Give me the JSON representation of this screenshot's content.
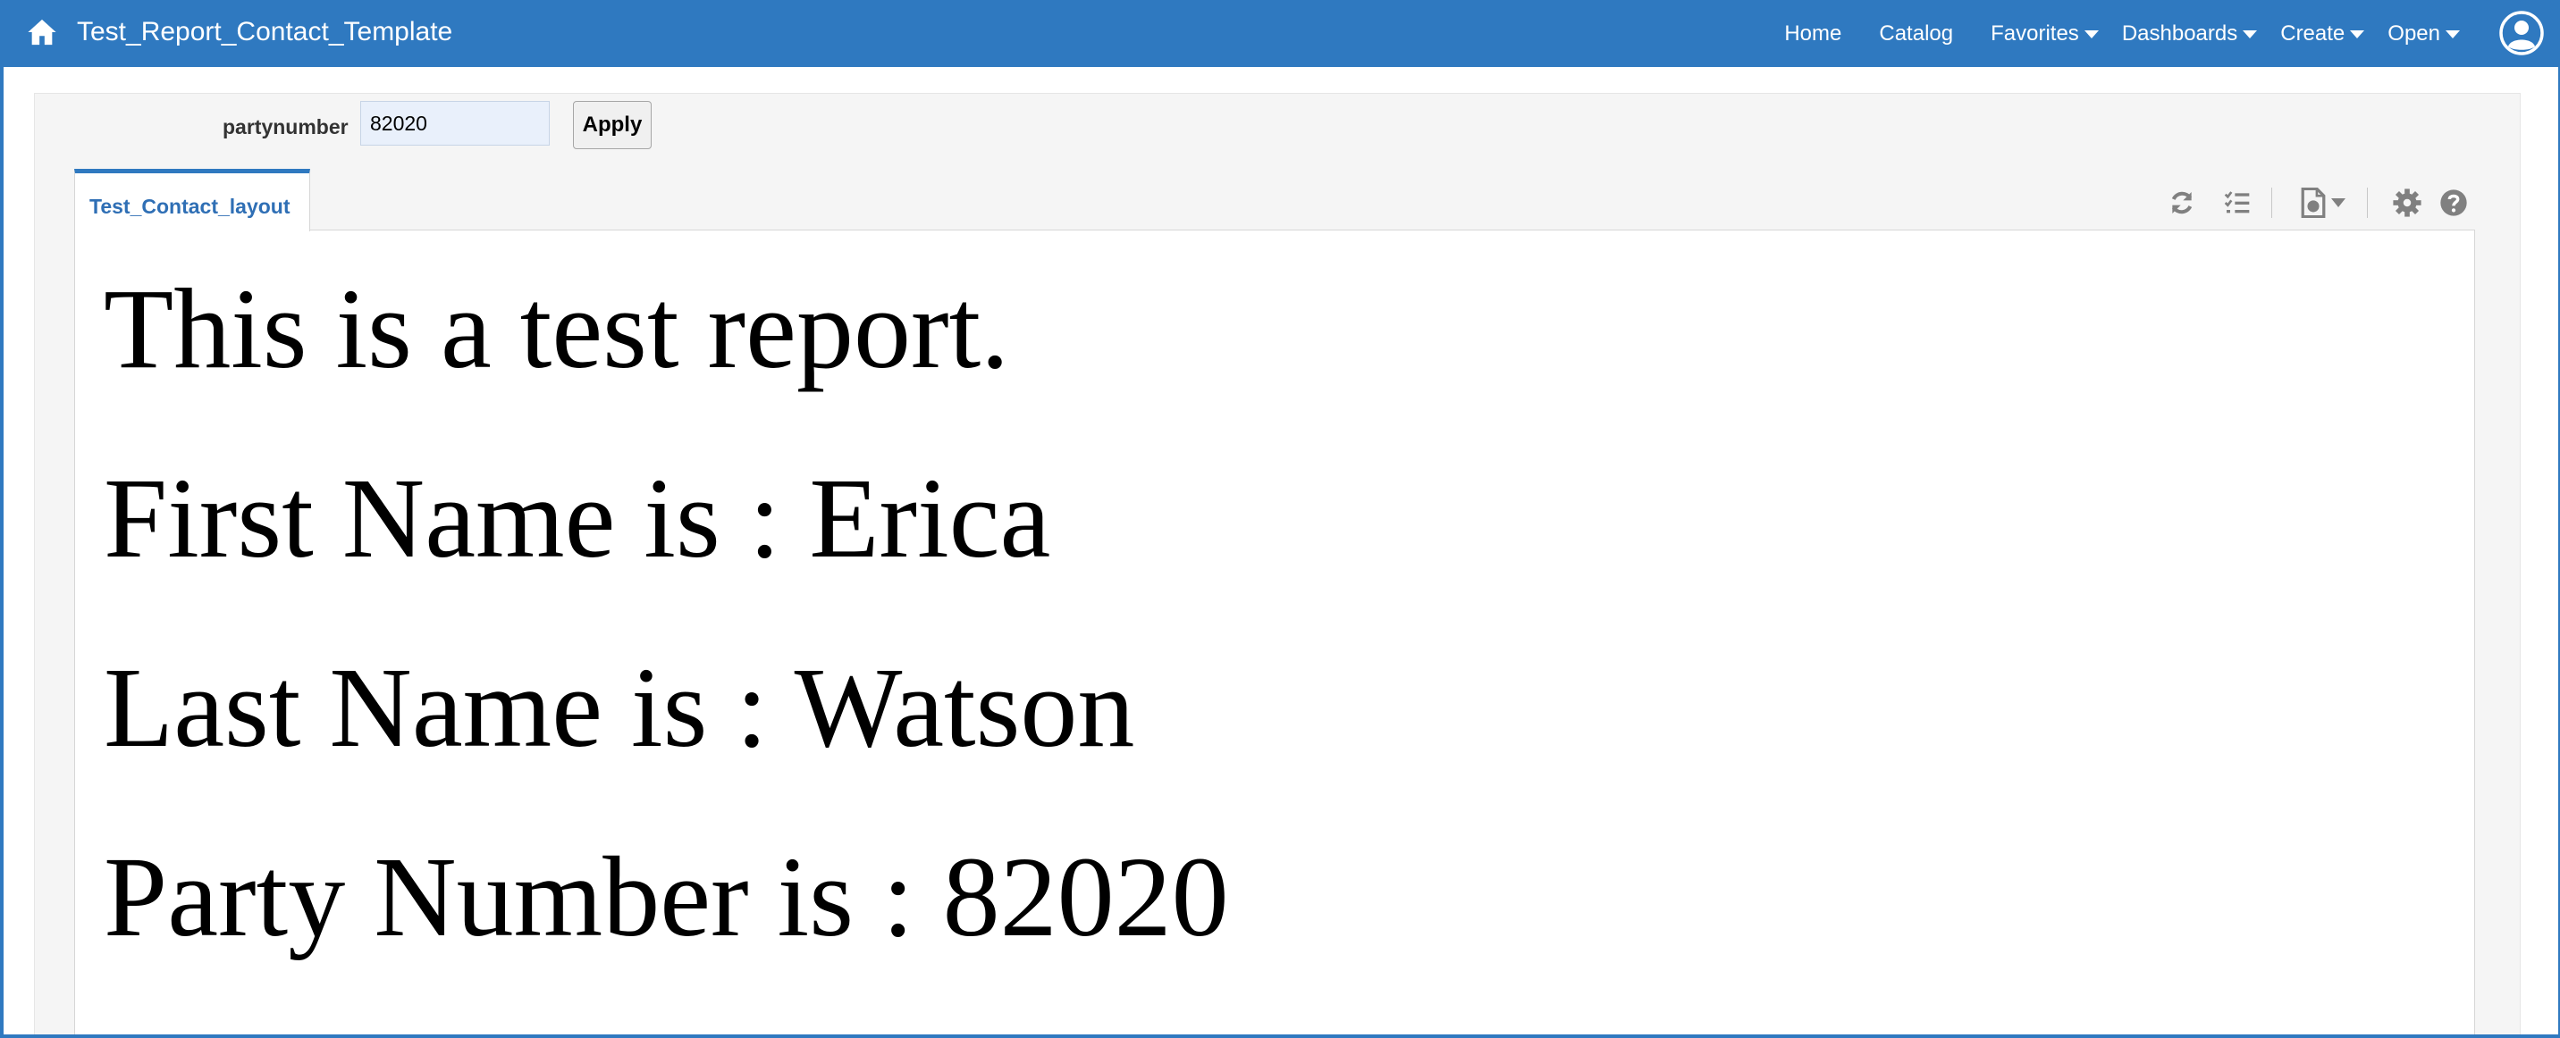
{
  "header": {
    "title": "Test_Report_Contact_Template",
    "nav": {
      "home": "Home",
      "catalog": "Catalog",
      "favorites": "Favorites",
      "dashboards": "Dashboards",
      "create": "Create",
      "open": "Open"
    }
  },
  "params": {
    "label": "partynumber",
    "value": "82020",
    "apply_label": "Apply"
  },
  "tabs": [
    {
      "label": "Test_Contact_layout",
      "active": true
    }
  ],
  "toolbar": {
    "icons": [
      "refresh-icon",
      "list-icon",
      "export-icon",
      "settings-icon",
      "help-icon"
    ]
  },
  "report": {
    "line1": "This is a test report.",
    "line2": "First Name is : Erica",
    "line3": "Last Name is : Watson",
    "line4": "Party Number is : 82020"
  },
  "colors": {
    "brand": "#2f79c0",
    "panel": "#f5f5f5",
    "tab_text": "#2f6fb5",
    "icon_gray": "#808080"
  }
}
